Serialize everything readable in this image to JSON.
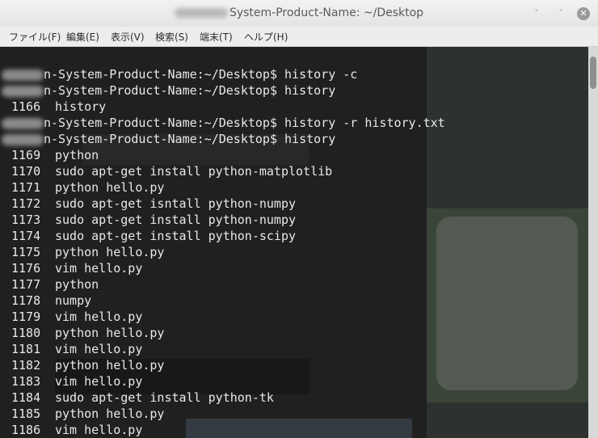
{
  "window": {
    "title": "System-Product-Name: ~/Desktop"
  },
  "controls": {
    "minimize": "˅",
    "maximize": "˄",
    "close": "✕"
  },
  "menu": {
    "items": [
      "ファイル(F)",
      "編集(E)",
      "表示(V)",
      "検索(S)",
      "端末(T)",
      "ヘルプ(H)"
    ]
  },
  "terminal": {
    "lines": [
      {
        "kind": "prompt",
        "prompt": "n-System-Product-Name:~/Desktop$",
        "command": "history -c"
      },
      {
        "kind": "prompt",
        "prompt": "n-System-Product-Name:~/Desktop$",
        "command": "history"
      },
      {
        "kind": "entry",
        "num": "1166",
        "command": "history"
      },
      {
        "kind": "prompt",
        "prompt": "n-System-Product-Name:~/Desktop$",
        "command": "history -r history.txt"
      },
      {
        "kind": "prompt",
        "prompt": "n-System-Product-Name:~/Desktop$",
        "command": "history"
      },
      {
        "kind": "entry",
        "num": "1169",
        "command": "python"
      },
      {
        "kind": "entry",
        "num": "1170",
        "command": "sudo apt-get install python-matplotlib"
      },
      {
        "kind": "entry",
        "num": "1171",
        "command": "python hello.py"
      },
      {
        "kind": "entry",
        "num": "1172",
        "command": "sudo apt-get isntall python-numpy"
      },
      {
        "kind": "entry",
        "num": "1173",
        "command": "sudo apt-get install python-numpy"
      },
      {
        "kind": "entry",
        "num": "1174",
        "command": "sudo apt-get install python-scipy"
      },
      {
        "kind": "entry",
        "num": "1175",
        "command": "python hello.py"
      },
      {
        "kind": "entry",
        "num": "1176",
        "command": "vim hello.py"
      },
      {
        "kind": "entry",
        "num": "1177",
        "command": "python"
      },
      {
        "kind": "entry",
        "num": "1178",
        "command": "numpy"
      },
      {
        "kind": "entry",
        "num": "1179",
        "command": "vim hello.py"
      },
      {
        "kind": "entry",
        "num": "1180",
        "command": "python hello.py"
      },
      {
        "kind": "entry",
        "num": "1181",
        "command": "vim hello.py"
      },
      {
        "kind": "entry",
        "num": "1182",
        "command": "python hello.py"
      },
      {
        "kind": "entry",
        "num": "1183",
        "command": "vim hello.py"
      },
      {
        "kind": "entry",
        "num": "1184",
        "command": "sudo apt-get install python-tk"
      },
      {
        "kind": "entry",
        "num": "1185",
        "command": "python hello.py"
      },
      {
        "kind": "entry",
        "num": "1186",
        "command": "vim hello.py"
      }
    ]
  },
  "colors": {
    "terminal_bg": "#202020",
    "terminal_fg": "#e8e8e8",
    "titlebar_bg": "#ececec"
  }
}
